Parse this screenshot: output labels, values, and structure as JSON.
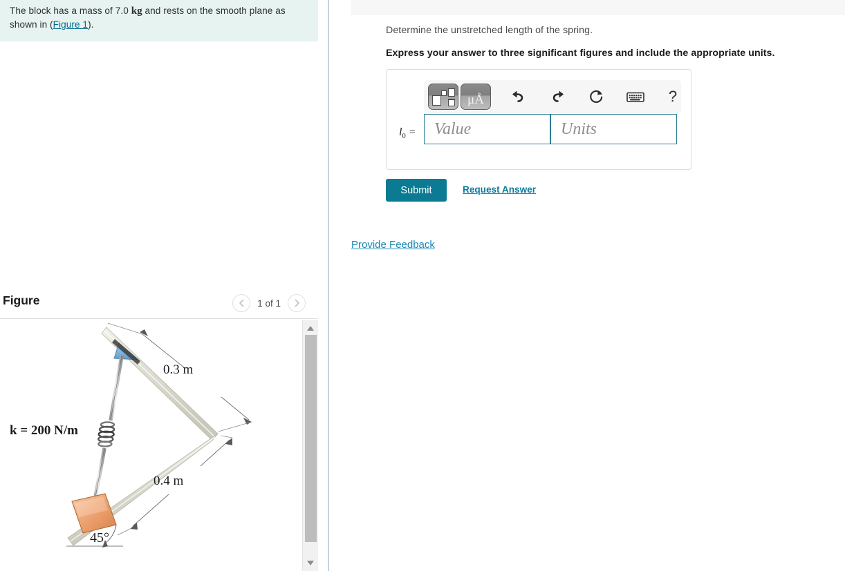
{
  "problem": {
    "text_before_unit": "The block has a mass of 7.0 ",
    "unit": "kg",
    "text_after_unit": " and rests on the smooth plane as shown in (",
    "figure_link": "Figure 1",
    "text_end": ")."
  },
  "figure_panel": {
    "title": "Figure",
    "pager_label": "1 of 1",
    "prev_icon": "chevron-left-icon",
    "next_icon": "chevron-right-icon",
    "scroll_up_icon": "scroll-up-arrow-icon",
    "scroll_down_icon": "scroll-down-arrow-icon"
  },
  "figure_diagram": {
    "spring_label": "k = 200 N/m",
    "dimension_top": "0.3 m",
    "dimension_bottom": "0.4 m",
    "angle_label": "45°",
    "block_color": "#eb9a63",
    "incline_color": "#dcdbd0",
    "bracket_color": "#7fb4de"
  },
  "question": {
    "prompt": "Determine the unstretched length of the spring.",
    "instruction": "Express your answer to three significant figures and include the appropriate units."
  },
  "answer_form": {
    "label": "l",
    "label_sub": "0",
    "label_eq": " =",
    "value_placeholder": "Value",
    "units_placeholder": "Units",
    "value_current": "",
    "units_current": "",
    "submit_label": "Submit",
    "request_answer_label": "Request Answer",
    "accent_color": "#0b7b93",
    "field_border_color": "#2a7f92",
    "toolbar": {
      "template_icon": "math-template-icon",
      "units_icon": "micro-angstrom-units-icon",
      "units_icon_label": "μÅ",
      "undo_icon": "undo-arrow-icon",
      "redo_icon": "redo-arrow-icon",
      "reset_icon": "reset-circular-arrow-icon",
      "keyboard_icon": "keyboard-icon",
      "help_icon": "help-question-mark-icon",
      "help_label": "?"
    }
  },
  "footer": {
    "provide_feedback_label": "Provide Feedback"
  }
}
